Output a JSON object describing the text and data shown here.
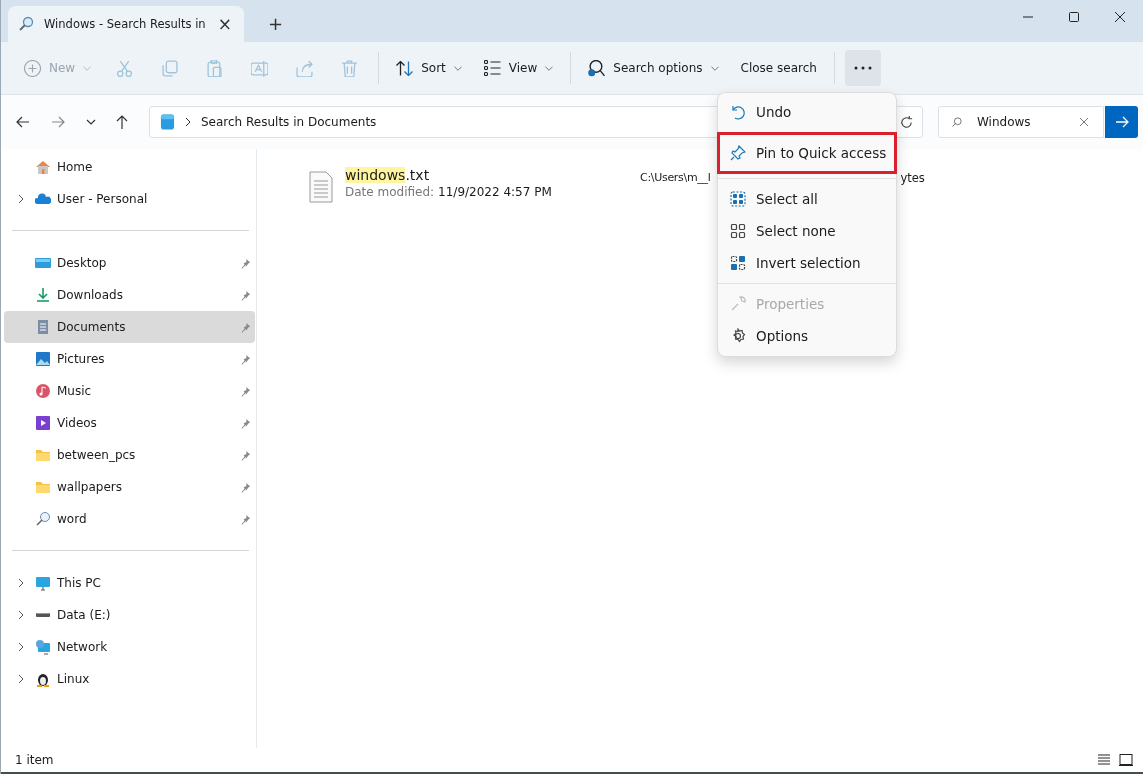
{
  "tabs": [
    {
      "title": "Windows - Search Results in",
      "selected": true,
      "close": "×"
    }
  ],
  "new_tab": "+",
  "toolbar": [
    {
      "kind": "new",
      "label": "New",
      "disabled": true,
      "dropdown": true
    },
    {
      "kind": "icon",
      "disabled": true
    },
    {
      "kind": "icon",
      "disabled": true
    },
    {
      "kind": "icon",
      "disabled": true
    },
    {
      "kind": "icon",
      "disabled": true
    },
    {
      "kind": "icon",
      "disabled": true
    },
    {
      "kind": "icon",
      "disabled": true
    },
    {
      "kind": "sep"
    },
    {
      "kind": "sort",
      "label": "Sort",
      "disabled": false,
      "dropdown": true
    },
    {
      "kind": "view",
      "label": "View",
      "disabled": false,
      "dropdown": true
    },
    {
      "kind": "sep"
    },
    {
      "kind": "search",
      "label": "Search options",
      "disabled": false,
      "dropdown": true
    },
    {
      "kind": "text",
      "label": "Close search",
      "disabled": false,
      "dropdown": false
    },
    {
      "kind": "sep"
    },
    {
      "kind": "more",
      "selected": true
    }
  ],
  "address": {
    "path": "Search Results in Documents"
  },
  "search": {
    "value": "Windows"
  },
  "sidebar": {
    "groups": [
      [
        {
          "label": "Home",
          "expandable": false,
          "pinned": false,
          "selected": false
        },
        {
          "label": "User - Personal",
          "expandable": true,
          "pinned": false,
          "selected": false
        }
      ],
      [
        {
          "label": "Desktop",
          "expandable": false,
          "pinned": true,
          "selected": false
        },
        {
          "label": "Downloads",
          "expandable": false,
          "pinned": true,
          "selected": false
        },
        {
          "label": "Documents",
          "expandable": false,
          "pinned": true,
          "selected": true
        },
        {
          "label": "Pictures",
          "expandable": false,
          "pinned": true,
          "selected": false
        },
        {
          "label": "Music",
          "expandable": false,
          "pinned": true,
          "selected": false
        },
        {
          "label": "Videos",
          "expandable": false,
          "pinned": true,
          "selected": false
        },
        {
          "label": "between_pcs",
          "expandable": false,
          "pinned": true,
          "selected": false
        },
        {
          "label": "wallpapers",
          "expandable": false,
          "pinned": true,
          "selected": false
        },
        {
          "label": "word",
          "expandable": false,
          "pinned": true,
          "selected": false
        }
      ],
      [
        {
          "label": "This PC",
          "expandable": true,
          "pinned": false,
          "selected": false
        },
        {
          "label": "Data (E:)",
          "expandable": true,
          "pinned": false,
          "selected": false
        },
        {
          "label": "Network",
          "expandable": true,
          "pinned": false,
          "selected": false
        },
        {
          "label": "Linux",
          "expandable": true,
          "pinned": false,
          "selected": false
        }
      ]
    ]
  },
  "results": [
    {
      "name": "windows.txt",
      "date_label": "Date modified:",
      "date": "11/9/2022 4:57 PM",
      "path": "C:\\Users\\m__l",
      "size": "ytes"
    }
  ],
  "menu": [
    {
      "kind": "item",
      "label": "Undo",
      "disabled": false,
      "highlighted": false
    },
    {
      "kind": "item",
      "label": "Pin to Quick access",
      "disabled": false,
      "highlighted": true
    },
    {
      "kind": "divider"
    },
    {
      "kind": "item",
      "label": "Select all",
      "disabled": false,
      "highlighted": false
    },
    {
      "kind": "item",
      "label": "Select none",
      "disabled": false,
      "highlighted": false
    },
    {
      "kind": "item",
      "label": "Invert selection",
      "disabled": false,
      "highlighted": false
    },
    {
      "kind": "divider"
    },
    {
      "kind": "item",
      "label": "Properties",
      "disabled": true,
      "highlighted": false
    },
    {
      "kind": "item",
      "label": "Options",
      "disabled": false,
      "highlighted": false
    }
  ],
  "status_bar": {
    "count": "1 item"
  }
}
